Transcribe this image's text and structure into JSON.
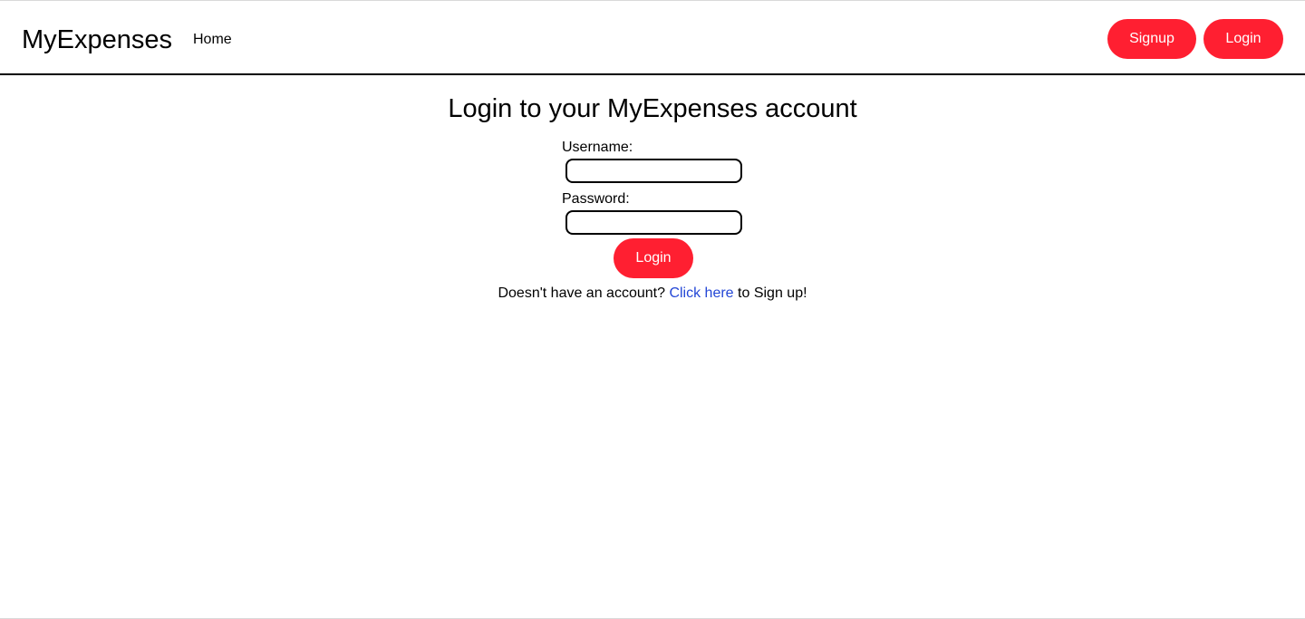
{
  "navbar": {
    "brand": "MyExpenses",
    "home_label": "Home",
    "signup_label": "Signup",
    "login_label": "Login"
  },
  "login": {
    "title": "Login to your MyExpenses account",
    "username_label": "Username:",
    "username_value": "",
    "password_label": "Password:",
    "password_value": "",
    "submit_label": "Login",
    "signup_prompt_before": "Doesn't have an account?",
    "signup_link": "Click here",
    "signup_prompt_after": "to Sign up!"
  },
  "colors": {
    "accent": "#ff1f31",
    "link": "#2447d6"
  }
}
